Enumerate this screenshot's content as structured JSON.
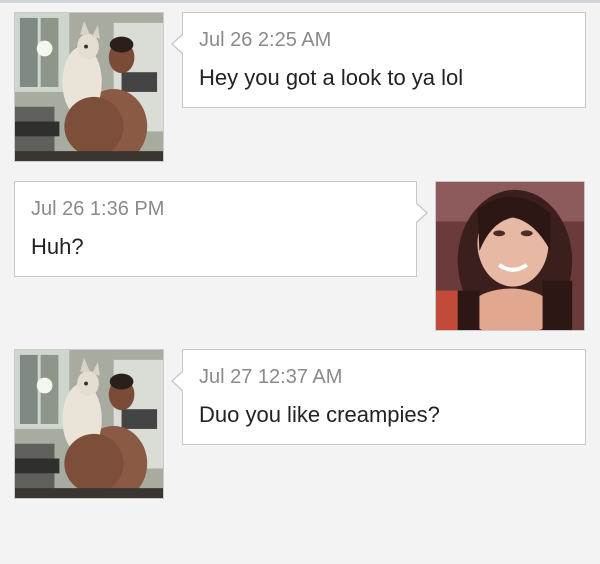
{
  "colors": {
    "background": "#f3f3f3",
    "bubble": "#ffffff",
    "bubble_border": "#c8c8c8",
    "timestamp": "#8a8a8a",
    "message_text": "#222222"
  },
  "messages": [
    {
      "sender": "other",
      "avatar": "man-with-dog-photo",
      "timestamp": "Jul 26 2:25 AM",
      "text": "Hey you got a look to ya lol"
    },
    {
      "sender": "self",
      "avatar": "woman-selfie-photo",
      "timestamp": "Jul 26 1:36 PM",
      "text": "Huh?"
    },
    {
      "sender": "other",
      "avatar": "man-with-dog-photo",
      "timestamp": "Jul 27 12:37 AM",
      "text": "Duo you like creampies?"
    }
  ]
}
